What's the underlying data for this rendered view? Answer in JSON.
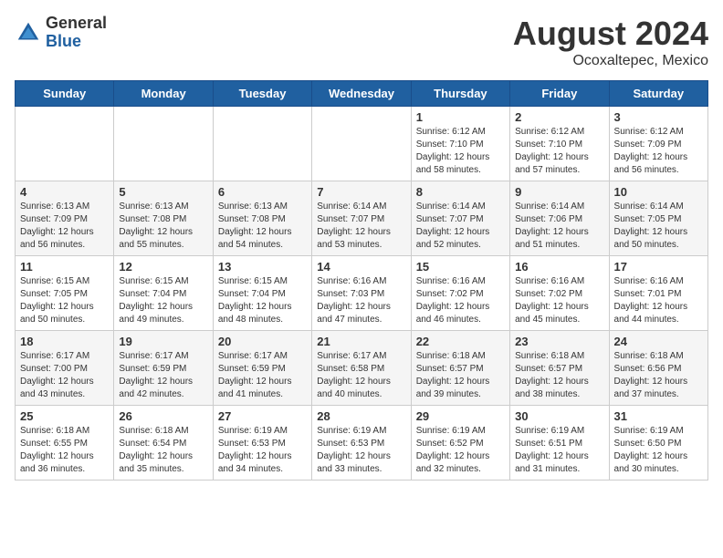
{
  "logo": {
    "general": "General",
    "blue": "Blue"
  },
  "title": "August 2024",
  "location": "Ocoxaltepec, Mexico",
  "days_header": [
    "Sunday",
    "Monday",
    "Tuesday",
    "Wednesday",
    "Thursday",
    "Friday",
    "Saturday"
  ],
  "weeks": [
    [
      {
        "day": "",
        "info": ""
      },
      {
        "day": "",
        "info": ""
      },
      {
        "day": "",
        "info": ""
      },
      {
        "day": "",
        "info": ""
      },
      {
        "day": "1",
        "info": "Sunrise: 6:12 AM\nSunset: 7:10 PM\nDaylight: 12 hours\nand 58 minutes."
      },
      {
        "day": "2",
        "info": "Sunrise: 6:12 AM\nSunset: 7:10 PM\nDaylight: 12 hours\nand 57 minutes."
      },
      {
        "day": "3",
        "info": "Sunrise: 6:12 AM\nSunset: 7:09 PM\nDaylight: 12 hours\nand 56 minutes."
      }
    ],
    [
      {
        "day": "4",
        "info": "Sunrise: 6:13 AM\nSunset: 7:09 PM\nDaylight: 12 hours\nand 56 minutes."
      },
      {
        "day": "5",
        "info": "Sunrise: 6:13 AM\nSunset: 7:08 PM\nDaylight: 12 hours\nand 55 minutes."
      },
      {
        "day": "6",
        "info": "Sunrise: 6:13 AM\nSunset: 7:08 PM\nDaylight: 12 hours\nand 54 minutes."
      },
      {
        "day": "7",
        "info": "Sunrise: 6:14 AM\nSunset: 7:07 PM\nDaylight: 12 hours\nand 53 minutes."
      },
      {
        "day": "8",
        "info": "Sunrise: 6:14 AM\nSunset: 7:07 PM\nDaylight: 12 hours\nand 52 minutes."
      },
      {
        "day": "9",
        "info": "Sunrise: 6:14 AM\nSunset: 7:06 PM\nDaylight: 12 hours\nand 51 minutes."
      },
      {
        "day": "10",
        "info": "Sunrise: 6:14 AM\nSunset: 7:05 PM\nDaylight: 12 hours\nand 50 minutes."
      }
    ],
    [
      {
        "day": "11",
        "info": "Sunrise: 6:15 AM\nSunset: 7:05 PM\nDaylight: 12 hours\nand 50 minutes."
      },
      {
        "day": "12",
        "info": "Sunrise: 6:15 AM\nSunset: 7:04 PM\nDaylight: 12 hours\nand 49 minutes."
      },
      {
        "day": "13",
        "info": "Sunrise: 6:15 AM\nSunset: 7:04 PM\nDaylight: 12 hours\nand 48 minutes."
      },
      {
        "day": "14",
        "info": "Sunrise: 6:16 AM\nSunset: 7:03 PM\nDaylight: 12 hours\nand 47 minutes."
      },
      {
        "day": "15",
        "info": "Sunrise: 6:16 AM\nSunset: 7:02 PM\nDaylight: 12 hours\nand 46 minutes."
      },
      {
        "day": "16",
        "info": "Sunrise: 6:16 AM\nSunset: 7:02 PM\nDaylight: 12 hours\nand 45 minutes."
      },
      {
        "day": "17",
        "info": "Sunrise: 6:16 AM\nSunset: 7:01 PM\nDaylight: 12 hours\nand 44 minutes."
      }
    ],
    [
      {
        "day": "18",
        "info": "Sunrise: 6:17 AM\nSunset: 7:00 PM\nDaylight: 12 hours\nand 43 minutes."
      },
      {
        "day": "19",
        "info": "Sunrise: 6:17 AM\nSunset: 6:59 PM\nDaylight: 12 hours\nand 42 minutes."
      },
      {
        "day": "20",
        "info": "Sunrise: 6:17 AM\nSunset: 6:59 PM\nDaylight: 12 hours\nand 41 minutes."
      },
      {
        "day": "21",
        "info": "Sunrise: 6:17 AM\nSunset: 6:58 PM\nDaylight: 12 hours\nand 40 minutes."
      },
      {
        "day": "22",
        "info": "Sunrise: 6:18 AM\nSunset: 6:57 PM\nDaylight: 12 hours\nand 39 minutes."
      },
      {
        "day": "23",
        "info": "Sunrise: 6:18 AM\nSunset: 6:57 PM\nDaylight: 12 hours\nand 38 minutes."
      },
      {
        "day": "24",
        "info": "Sunrise: 6:18 AM\nSunset: 6:56 PM\nDaylight: 12 hours\nand 37 minutes."
      }
    ],
    [
      {
        "day": "25",
        "info": "Sunrise: 6:18 AM\nSunset: 6:55 PM\nDaylight: 12 hours\nand 36 minutes."
      },
      {
        "day": "26",
        "info": "Sunrise: 6:18 AM\nSunset: 6:54 PM\nDaylight: 12 hours\nand 35 minutes."
      },
      {
        "day": "27",
        "info": "Sunrise: 6:19 AM\nSunset: 6:53 PM\nDaylight: 12 hours\nand 34 minutes."
      },
      {
        "day": "28",
        "info": "Sunrise: 6:19 AM\nSunset: 6:53 PM\nDaylight: 12 hours\nand 33 minutes."
      },
      {
        "day": "29",
        "info": "Sunrise: 6:19 AM\nSunset: 6:52 PM\nDaylight: 12 hours\nand 32 minutes."
      },
      {
        "day": "30",
        "info": "Sunrise: 6:19 AM\nSunset: 6:51 PM\nDaylight: 12 hours\nand 31 minutes."
      },
      {
        "day": "31",
        "info": "Sunrise: 6:19 AM\nSunset: 6:50 PM\nDaylight: 12 hours\nand 30 minutes."
      }
    ]
  ]
}
